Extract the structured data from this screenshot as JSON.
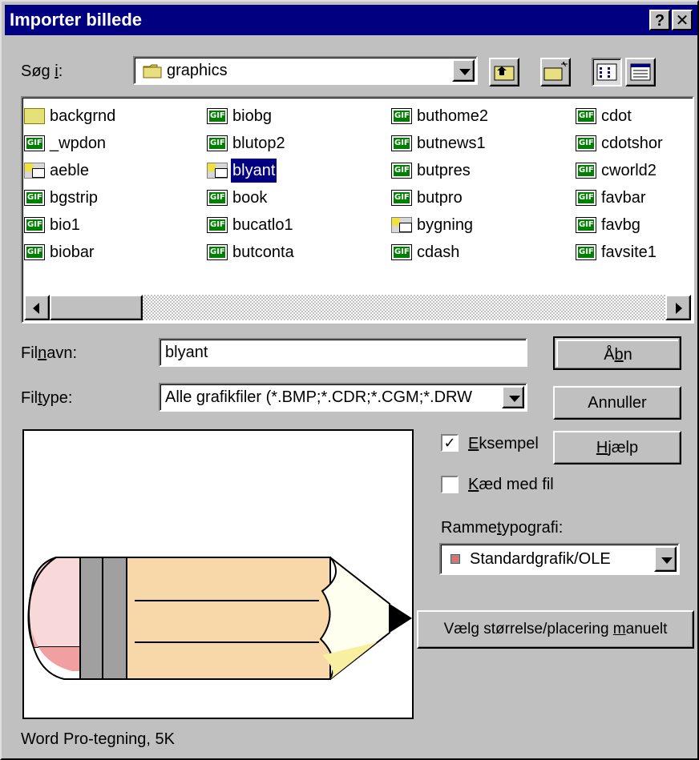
{
  "dialog": {
    "title": "Importer billede",
    "help_glyph": "?",
    "close_glyph": "✕"
  },
  "lookin": {
    "label": "Søg i:",
    "value": "graphics",
    "icon": "folder-icon"
  },
  "toolbar": {
    "up_icon": "up-one-level-icon",
    "newfolder_icon": "new-folder-icon",
    "list_icon": "list-view-icon",
    "details_icon": "details-view-icon"
  },
  "files": {
    "columns": [
      [
        {
          "name": "backgrnd",
          "type": "folder"
        },
        {
          "name": "_wpdon",
          "type": "gif"
        },
        {
          "name": "aeble",
          "type": "image"
        },
        {
          "name": "bgstrip",
          "type": "gif"
        },
        {
          "name": "bio1",
          "type": "gif"
        },
        {
          "name": "biobar",
          "type": "gif"
        }
      ],
      [
        {
          "name": "biobg",
          "type": "gif"
        },
        {
          "name": "blutop2",
          "type": "gif"
        },
        {
          "name": "blyant",
          "type": "image",
          "selected": true
        },
        {
          "name": "book",
          "type": "gif"
        },
        {
          "name": "bucatlo1",
          "type": "gif"
        },
        {
          "name": "butconta",
          "type": "gif"
        }
      ],
      [
        {
          "name": "buthome2",
          "type": "gif"
        },
        {
          "name": "butnews1",
          "type": "gif"
        },
        {
          "name": "butpres",
          "type": "gif"
        },
        {
          "name": "butpro",
          "type": "gif"
        },
        {
          "name": "bygning",
          "type": "image"
        },
        {
          "name": "cdash",
          "type": "gif"
        }
      ],
      [
        {
          "name": "cdot",
          "type": "gif"
        },
        {
          "name": "cdotshor",
          "type": "gif"
        },
        {
          "name": "cworld2",
          "type": "gif"
        },
        {
          "name": "favbar",
          "type": "gif"
        },
        {
          "name": "favbg",
          "type": "gif"
        },
        {
          "name": "favsite1",
          "type": "gif"
        }
      ]
    ]
  },
  "filename": {
    "label": "Filnavn:",
    "value": "blyant"
  },
  "filetype": {
    "label": "Filtype:",
    "value": "Alle grafikfiler (*.BMP;*.CDR;*.CGM;*.DRW"
  },
  "buttons": {
    "open": "Åbn",
    "cancel": "Annuller",
    "help": "Hjælp",
    "manual": "Vælg størrelse/placering manuelt"
  },
  "options": {
    "preview_label": "Eksempel",
    "preview_checked": true,
    "link_label": "Kæd med fil",
    "link_checked": false
  },
  "frame_style": {
    "label": "Rammetypografi:",
    "value": "Standardgrafik/OLE"
  },
  "status": {
    "text": "Word Pro-tegning, 5K"
  }
}
